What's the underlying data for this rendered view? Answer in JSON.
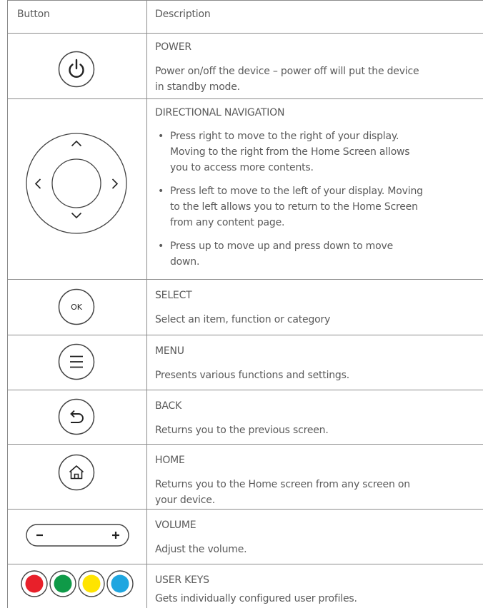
{
  "header": {
    "button": "Button",
    "description": "Description"
  },
  "rows": [
    {
      "icon": "power-icon",
      "title": "POWER",
      "lines": [
        "Power on/off the device – power off will put the device",
        "in standby mode."
      ]
    },
    {
      "icon": "directional-pad-icon",
      "title": "DIRECTIONAL NAVIGATION",
      "bullets": [
        [
          "Press right to move to the right of your display.",
          "Moving to the right from the Home Screen allows",
          "you to access more contents."
        ],
        [
          "Press left to move to the left of your display. Moving",
          "to the left allows you to return to the Home Screen",
          "from any content page."
        ],
        [
          "Press up to move up and press down to move",
          "down."
        ]
      ]
    },
    {
      "icon": "ok-icon",
      "icon_label": "OK",
      "title": "SELECT",
      "lines": [
        "Select an item, function or category"
      ]
    },
    {
      "icon": "menu-icon",
      "title": "MENU",
      "lines": [
        "Presents various functions and settings."
      ]
    },
    {
      "icon": "back-icon",
      "title": "BACK",
      "lines": [
        "Returns you to the previous screen."
      ]
    },
    {
      "icon": "home-icon",
      "title": "HOME",
      "lines": [
        "Returns you to the Home screen from any screen on",
        "your device."
      ]
    },
    {
      "icon": "volume-rocker-icon",
      "title": "VOLUME",
      "lines": [
        "Adjust the volume."
      ]
    },
    {
      "icon": "color-keys-icon",
      "title": "USER KEYS",
      "lines": [
        "Gets individually configured user profiles."
      ],
      "key_colors": [
        "#e8202a",
        "#0f9a48",
        "#ffe400",
        "#1ea6e0"
      ]
    }
  ],
  "colors": {
    "border": "#8c8c8c",
    "text": "#5a5a5a",
    "icon_stroke": "#444444"
  }
}
